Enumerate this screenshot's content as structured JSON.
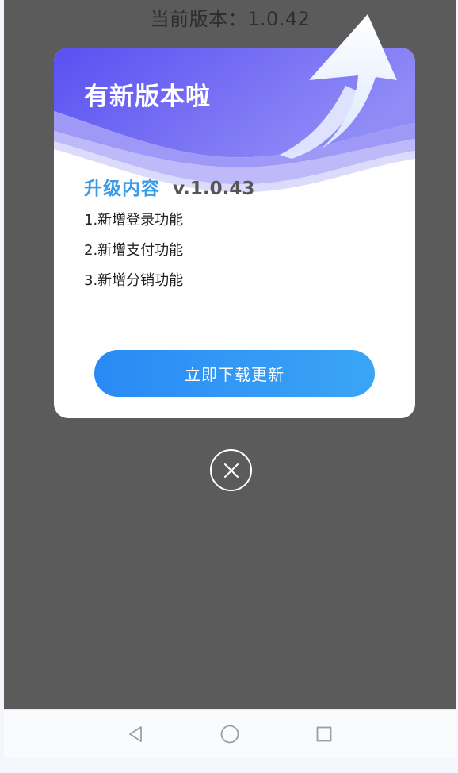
{
  "background": {
    "current_version_label": "当前版本：1.0.42"
  },
  "update_dialog": {
    "title": "有新版本啦",
    "section_label": "升级内容",
    "version": "v.1.0.43",
    "changes": [
      "1.新增登录功能",
      "2.新增支付功能",
      "3.新增分销功能"
    ],
    "download_button_label": "立即下载更新",
    "close_icon": "close-circle-icon",
    "header_icon": "arrow-up-icon"
  },
  "navigation_bar": {
    "buttons": [
      {
        "name": "back",
        "icon": "triangle-back-icon"
      },
      {
        "name": "home",
        "icon": "circle-home-icon"
      },
      {
        "name": "recents",
        "icon": "square-recents-icon"
      }
    ]
  },
  "colors": {
    "overlay": "#5b5b5b",
    "header_gradient_start": "#5a4ff2",
    "header_gradient_end": "#8f8cf6",
    "accent_blue": "#3b9be8",
    "button_gradient_start": "#2a8af5",
    "button_gradient_end": "#3aa5f5"
  }
}
